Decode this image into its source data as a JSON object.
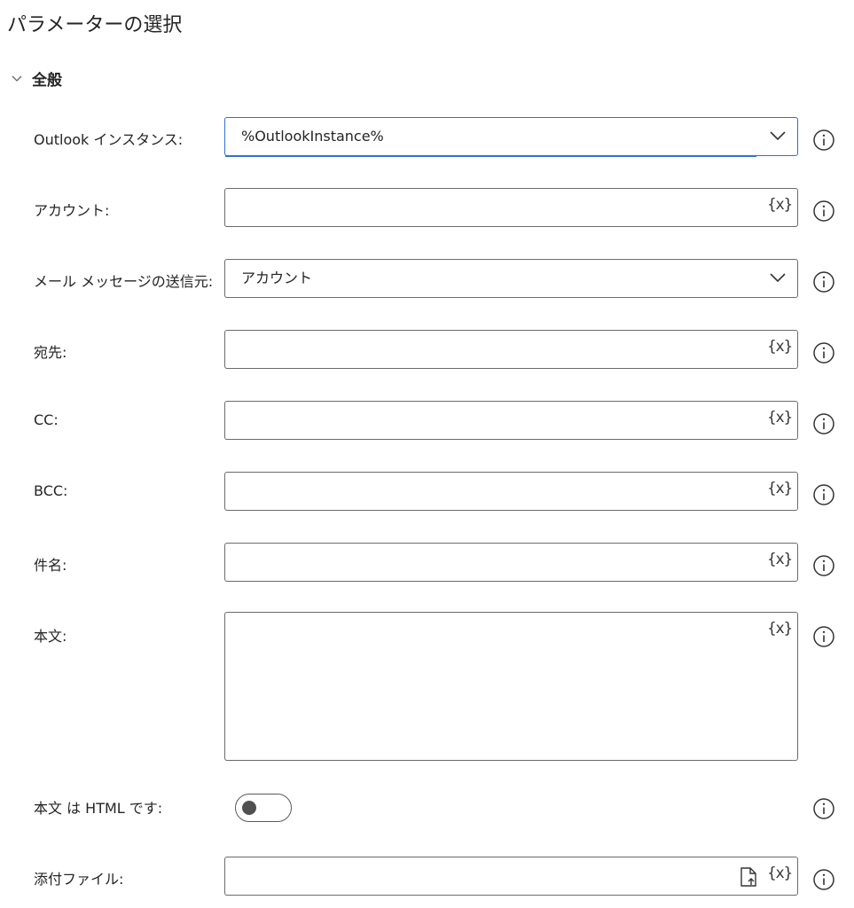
{
  "page": {
    "title": "パラメーターの選択"
  },
  "section": {
    "title": "全般"
  },
  "fields": {
    "outlook_instance": {
      "label": "Outlook インスタンス:",
      "value": "%OutlookInstance%"
    },
    "account": {
      "label": "アカウント:",
      "value": ""
    },
    "send_from": {
      "label": "メール メッセージの送信元:",
      "value": "アカウント"
    },
    "to": {
      "label": "宛先:",
      "value": ""
    },
    "cc": {
      "label": "CC:",
      "value": ""
    },
    "bcc": {
      "label": "BCC:",
      "value": ""
    },
    "subject": {
      "label": "件名:",
      "value": ""
    },
    "body": {
      "label": "本文:",
      "value": ""
    },
    "body_is_html": {
      "label": "本文 は HTML です:",
      "checked": false
    },
    "attachments": {
      "label": "添付ファイル:",
      "value": ""
    }
  },
  "variable_button_label": "{x}",
  "icons": {
    "collapse": "chevron-down-icon",
    "dropdown": "chevron-down-icon",
    "info": "info-icon",
    "file": "file-upload-icon"
  },
  "colors": {
    "focus": "#2f6fd6",
    "border": "#6b6b6b",
    "text": "#242424"
  }
}
